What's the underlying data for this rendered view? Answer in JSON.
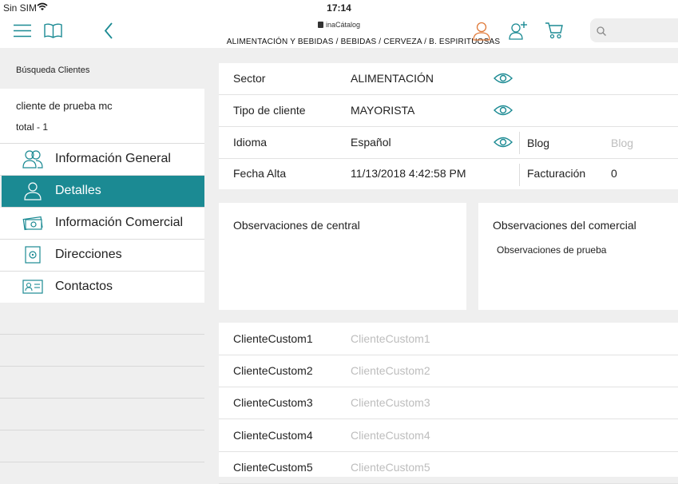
{
  "status_bar": {
    "carrier": "Sin SIM",
    "time": "17:14"
  },
  "nav": {
    "brand": "inaCátalog",
    "breadcrumb": "ALIMENTACIÓN Y BEBIDAS / BEBIDAS / CERVEZA / B. ESPIRITUOSAS",
    "accent_color": "#1b8a93",
    "user_icon_color": "#e07a3a",
    "icons": [
      "menu-icon",
      "book-icon",
      "back-chevron-icon",
      "user-icon",
      "add-user-icon",
      "cart-icon",
      "search-icon"
    ]
  },
  "sidebar": {
    "title": "Búsqueda Clientes",
    "client_name": "cliente de prueba mc",
    "client_total": "total - 1",
    "items": [
      {
        "label": "Información General",
        "icon": "users-icon",
        "active": false
      },
      {
        "label": "Detalles",
        "icon": "user-icon",
        "active": true
      },
      {
        "label": "Información Comercial",
        "icon": "money-icon",
        "active": false
      },
      {
        "label": "Direcciones",
        "icon": "safe-icon",
        "active": false
      },
      {
        "label": "Contactos",
        "icon": "contact-card-icon",
        "active": false
      }
    ]
  },
  "details": {
    "sector": {
      "label": "Sector",
      "value": "ALIMENTACIÓN"
    },
    "tipo_cliente": {
      "label": "Tipo de cliente",
      "value": "MAYORISTA"
    },
    "idioma": {
      "label": "Idioma",
      "value": "Español"
    },
    "blog": {
      "label": "Blog",
      "placeholder": "Blog"
    },
    "fecha_alta": {
      "label": "Fecha Alta",
      "value": "11/13/2018 4:42:58 PM"
    },
    "facturacion": {
      "label": "Facturación",
      "value": "0"
    }
  },
  "observaciones": {
    "central": {
      "title": "Observaciones de central",
      "text": ""
    },
    "comercial": {
      "title": "Observaciones del comercial",
      "text": "Observaciones de prueba"
    }
  },
  "custom_fields": [
    {
      "label": "ClienteCustom1",
      "placeholder": "ClienteCustom1"
    },
    {
      "label": "ClienteCustom2",
      "placeholder": "ClienteCustom2"
    },
    {
      "label": "ClienteCustom3",
      "placeholder": "ClienteCustom3"
    },
    {
      "label": "ClienteCustom4",
      "placeholder": "ClienteCustom4"
    },
    {
      "label": "ClienteCustom5",
      "placeholder": "ClienteCustom5"
    }
  ]
}
